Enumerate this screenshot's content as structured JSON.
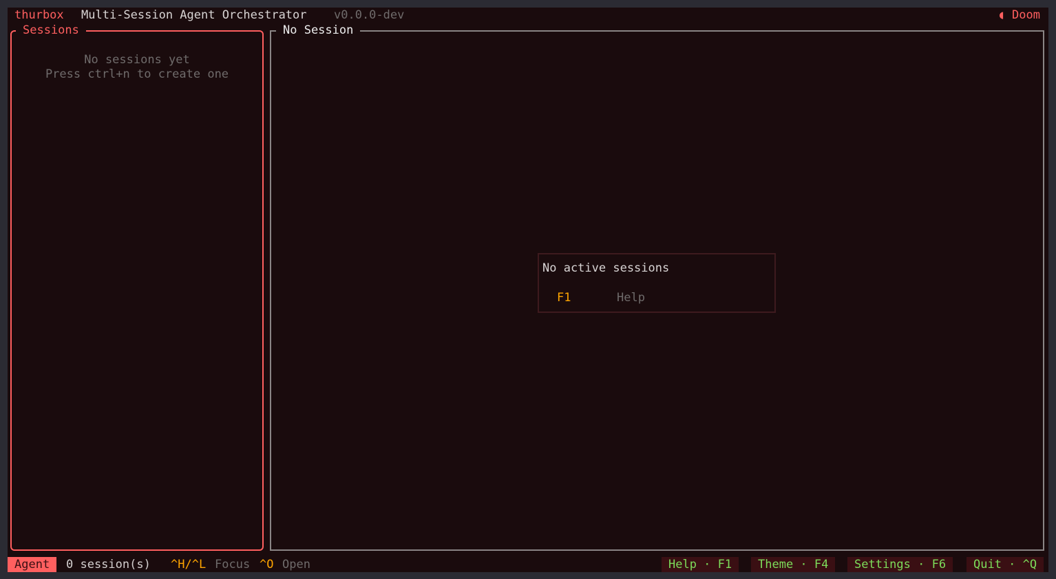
{
  "header": {
    "app_name": "thurbox",
    "app_title": "Multi-Session Agent Orchestrator",
    "version": "v0.0.0-dev",
    "theme_icon": "◖",
    "theme_name": "Doom"
  },
  "sessions_panel": {
    "title": "Sessions",
    "empty_line1": "No sessions yet",
    "empty_line2": "Press ctrl+n to create one"
  },
  "main_panel": {
    "title": "No Session",
    "dialog": {
      "title": "No active sessions",
      "key": "F1",
      "action": "Help"
    }
  },
  "statusbar": {
    "mode": "Agent",
    "session_count": "0 session(s)",
    "focus_keys": "^H/^L",
    "focus_label": "Focus",
    "open_key": "^O",
    "open_label": "Open",
    "shortcuts": [
      {
        "label": "Help · F1"
      },
      {
        "label": "Theme · F4"
      },
      {
        "label": "Settings · F6"
      },
      {
        "label": "Quit · ^Q"
      }
    ]
  },
  "colors": {
    "accent": "#ff5f5f",
    "background": "#1a0b0d",
    "key_highlight": "#ffa500",
    "shortcut_text": "#7ddc5a"
  }
}
